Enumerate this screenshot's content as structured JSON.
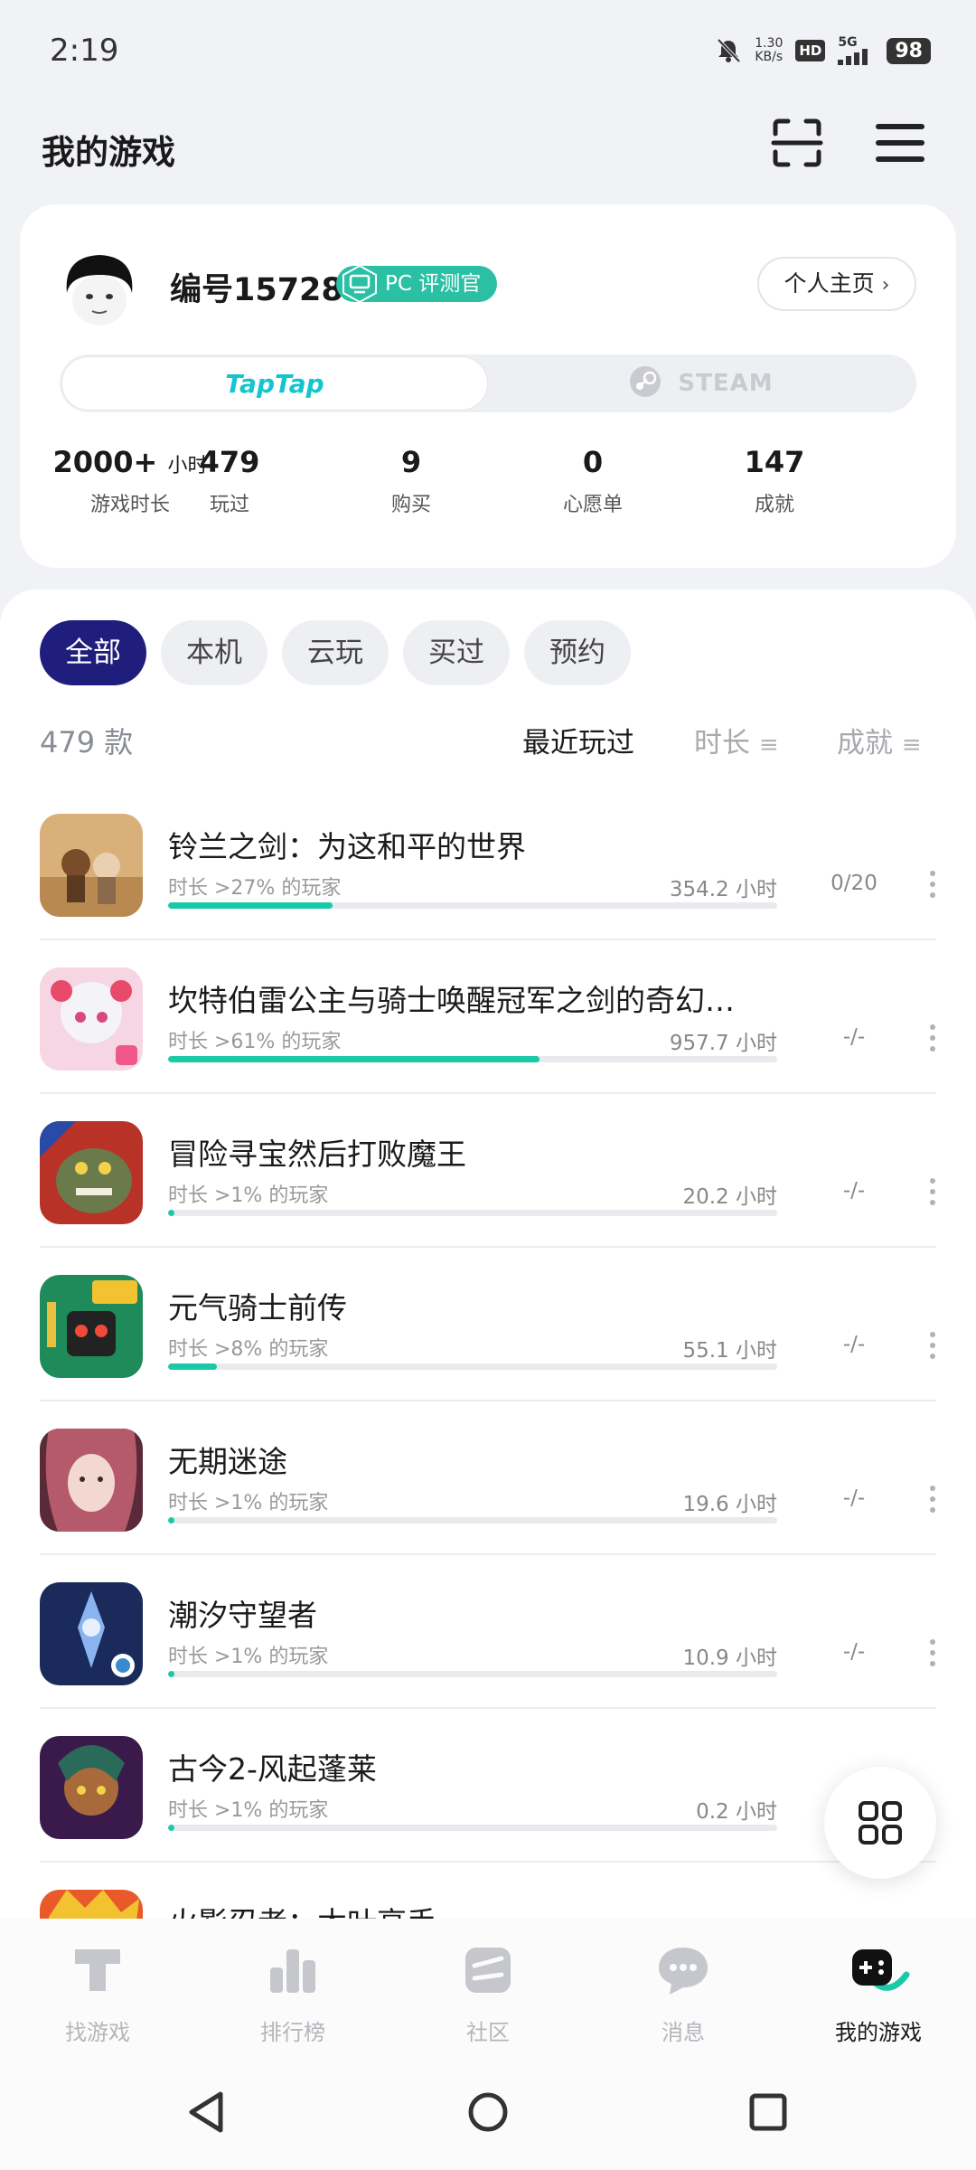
{
  "status_bar": {
    "time": "2:19",
    "net_speed_value": "1.30",
    "net_speed_unit": "KB/s",
    "hd": "HD",
    "network": "5G",
    "battery": "98"
  },
  "header": {
    "title": "我的游戏"
  },
  "profile": {
    "username": "编号15728",
    "badge": "PC 评测官",
    "homepage_button": "个人主页",
    "platform_tabs": [
      "TapTap",
      "STEAM"
    ],
    "stats": [
      {
        "value": "2000+",
        "unit": "小时",
        "label": "游戏时长"
      },
      {
        "value": "479",
        "unit": "",
        "label": "玩过"
      },
      {
        "value": "9",
        "unit": "",
        "label": "购买"
      },
      {
        "value": "0",
        "unit": "",
        "label": "心愿单"
      },
      {
        "value": "147",
        "unit": "",
        "label": "成就"
      }
    ]
  },
  "filters": [
    "全部",
    "本机",
    "云玩",
    "买过",
    "预约"
  ],
  "list_header": {
    "count": "479 款",
    "sort_recent": "最近玩过",
    "sort_duration": "时长",
    "sort_achievement": "成就"
  },
  "games": [
    {
      "name": "铃兰之剑：为这和平的世界",
      "rank": "时长 >27% 的玩家",
      "hours": "354.2 小时",
      "achievement": "0/20",
      "progress": 0.27,
      "icon": "game-icon-lingling"
    },
    {
      "name": "坎特伯雷公主与骑士唤醒冠军之剑的奇幻…",
      "rank": "时长 >61% 的玩家",
      "hours": "957.7 小时",
      "achievement": "-/-",
      "progress": 0.61,
      "icon": "game-icon-canterbury"
    },
    {
      "name": "冒险寻宝然后打败魔王",
      "rank": "时长 >1% 的玩家",
      "hours": "20.2 小时",
      "achievement": "-/-",
      "progress": 0.01,
      "icon": "game-icon-adventure"
    },
    {
      "name": "元气骑士前传",
      "rank": "时长 >8% 的玩家",
      "hours": "55.1 小时",
      "achievement": "-/-",
      "progress": 0.08,
      "icon": "game-icon-soul-knight"
    },
    {
      "name": "无期迷途",
      "rank": "时长 >1% 的玩家",
      "hours": "19.6 小时",
      "achievement": "-/-",
      "progress": 0.01,
      "icon": "game-icon-path-to-nowhere"
    },
    {
      "name": "潮汐守望者",
      "rank": "时长 >1% 的玩家",
      "hours": "10.9 小时",
      "achievement": "-/-",
      "progress": 0.01,
      "icon": "game-icon-tide-watcher"
    },
    {
      "name": "古今2-风起蓬莱",
      "rank": "时长 >1% 的玩家",
      "hours": "0.2 小时",
      "achievement": "",
      "progress": 0.01,
      "icon": "game-icon-gujin2"
    },
    {
      "name": "火影忍者：木叶高手",
      "rank": "",
      "hours": "",
      "achievement": "",
      "progress": 0,
      "icon": "game-icon-naruto"
    }
  ],
  "bottom_nav": [
    {
      "label": "找游戏",
      "icon": "find-games-icon"
    },
    {
      "label": "排行榜",
      "icon": "ranking-icon"
    },
    {
      "label": "社区",
      "icon": "community-icon"
    },
    {
      "label": "消息",
      "icon": "messages-icon"
    },
    {
      "label": "我的游戏",
      "icon": "my-games-icon",
      "active": true
    }
  ],
  "colors": {
    "accent": "#1f1e7c",
    "progress": "#19c9a7",
    "taptap": "#15c5ce",
    "badge": "#2bc0a4"
  }
}
